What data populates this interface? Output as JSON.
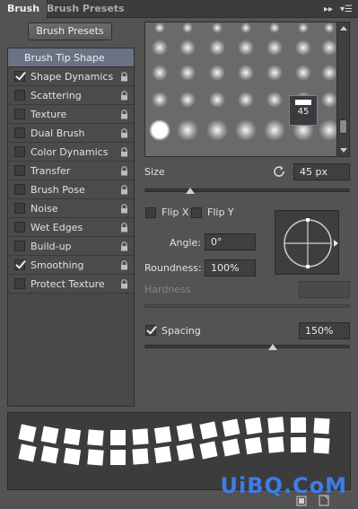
{
  "tabs": [
    {
      "label": "Brush"
    },
    {
      "label": "Brush Presets"
    }
  ],
  "preset_button": "Brush Presets",
  "options": {
    "header": "Brush Tip Shape",
    "items": [
      {
        "label": "Shape Dynamics",
        "checked": true,
        "locked": true
      },
      {
        "label": "Scattering",
        "checked": false,
        "locked": true
      },
      {
        "label": "Texture",
        "checked": false,
        "locked": true
      },
      {
        "label": "Dual Brush",
        "checked": false,
        "locked": true
      },
      {
        "label": "Color Dynamics",
        "checked": false,
        "locked": true
      },
      {
        "label": "Transfer",
        "checked": false,
        "locked": true
      },
      {
        "label": "Brush Pose",
        "checked": false,
        "locked": true
      },
      {
        "label": "Noise",
        "checked": false,
        "locked": true
      },
      {
        "label": "Wet Edges",
        "checked": false,
        "locked": true
      },
      {
        "label": "Build-up",
        "checked": false,
        "locked": true
      },
      {
        "label": "Smoothing",
        "checked": true,
        "locked": true
      },
      {
        "label": "Protect Texture",
        "checked": false,
        "locked": true
      }
    ]
  },
  "tip_grid": {
    "selected_size": "45"
  },
  "size": {
    "label": "Size",
    "value": "45 px",
    "slider_fraction": 0.22
  },
  "flip_x": {
    "label": "Flip X",
    "checked": false
  },
  "flip_y": {
    "label": "Flip Y",
    "checked": false
  },
  "angle": {
    "label": "Angle:",
    "value": "0°"
  },
  "roundness": {
    "label": "Roundness:",
    "value": "100%"
  },
  "hardness": {
    "label": "Hardness",
    "value": ""
  },
  "spacing": {
    "label": "Spacing",
    "checked": true,
    "value": "150%",
    "slider_fraction": 0.62
  },
  "watermark": "UiBQ.CoM",
  "colors": {
    "accent": "#5b86c8",
    "header": "#6a7284",
    "panel": "#535353",
    "watermark": "#3d7de8"
  }
}
